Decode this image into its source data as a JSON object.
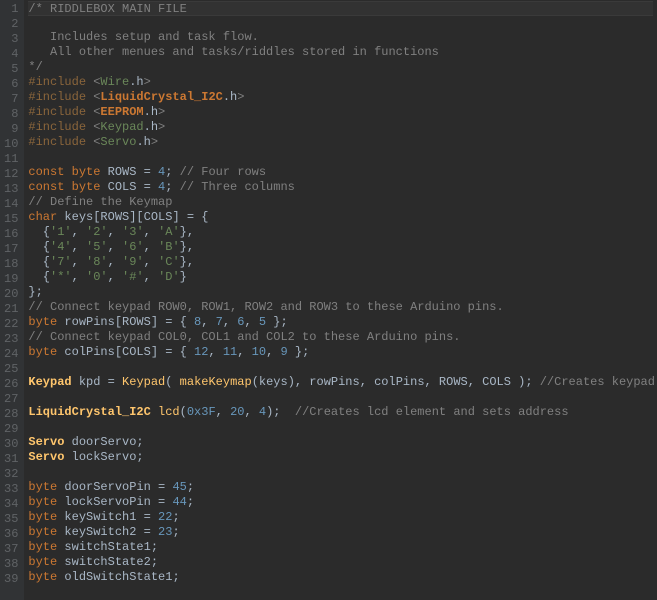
{
  "lines": [
    {
      "n": 1,
      "hl": true,
      "tokens": [
        {
          "c": "comment",
          "t": "/* RIDDLEBOX MAIN FILE"
        }
      ]
    },
    {
      "n": 2,
      "tokens": []
    },
    {
      "n": 3,
      "tokens": [
        {
          "c": "comment",
          "t": "   Includes setup and task flow."
        }
      ]
    },
    {
      "n": 4,
      "tokens": [
        {
          "c": "comment",
          "t": "   All other menues and tasks/riddles stored in functions"
        }
      ]
    },
    {
      "n": 5,
      "tokens": [
        {
          "c": "comment",
          "t": "*/"
        }
      ]
    },
    {
      "n": 6,
      "tokens": [
        {
          "c": "preproc",
          "t": "#include "
        },
        {
          "c": "inc-lt",
          "t": "<"
        },
        {
          "c": "inc-hdr",
          "t": "Wire"
        },
        {
          "c": "ident",
          "t": ".h"
        },
        {
          "c": "inc-lt",
          "t": ">"
        }
      ]
    },
    {
      "n": 7,
      "tokens": [
        {
          "c": "preproc",
          "t": "#include "
        },
        {
          "c": "inc-lt",
          "t": "<"
        },
        {
          "c": "inc-hdr-o",
          "t": "LiquidCrystal_I2C"
        },
        {
          "c": "ident",
          "t": ".h"
        },
        {
          "c": "inc-lt",
          "t": ">"
        }
      ]
    },
    {
      "n": 8,
      "tokens": [
        {
          "c": "preproc",
          "t": "#include "
        },
        {
          "c": "inc-lt",
          "t": "<"
        },
        {
          "c": "inc-hdr-o",
          "t": "EEPROM"
        },
        {
          "c": "ident",
          "t": ".h"
        },
        {
          "c": "inc-lt",
          "t": ">"
        }
      ]
    },
    {
      "n": 9,
      "tokens": [
        {
          "c": "preproc",
          "t": "#include "
        },
        {
          "c": "inc-lt",
          "t": "<"
        },
        {
          "c": "inc-hdr",
          "t": "Keypad"
        },
        {
          "c": "ident",
          "t": ".h"
        },
        {
          "c": "inc-lt",
          "t": ">"
        }
      ]
    },
    {
      "n": 10,
      "tokens": [
        {
          "c": "preproc",
          "t": "#include "
        },
        {
          "c": "inc-lt",
          "t": "<"
        },
        {
          "c": "inc-hdr",
          "t": "Servo"
        },
        {
          "c": "ident",
          "t": ".h"
        },
        {
          "c": "inc-lt",
          "t": ">"
        }
      ]
    },
    {
      "n": 11,
      "tokens": []
    },
    {
      "n": 12,
      "tokens": [
        {
          "c": "keyword",
          "t": "const byte"
        },
        {
          "c": "ident",
          "t": " ROWS = "
        },
        {
          "c": "number",
          "t": "4"
        },
        {
          "c": "ident",
          "t": "; "
        },
        {
          "c": "comment",
          "t": "// Four rows"
        }
      ]
    },
    {
      "n": 13,
      "tokens": [
        {
          "c": "keyword",
          "t": "const byte"
        },
        {
          "c": "ident",
          "t": " COLS = "
        },
        {
          "c": "number",
          "t": "4"
        },
        {
          "c": "ident",
          "t": "; "
        },
        {
          "c": "comment",
          "t": "// Three columns"
        }
      ]
    },
    {
      "n": 14,
      "tokens": [
        {
          "c": "comment",
          "t": "// Define the Keymap"
        }
      ]
    },
    {
      "n": 15,
      "tokens": [
        {
          "c": "keyword",
          "t": "char"
        },
        {
          "c": "ident",
          "t": " keys[ROWS][COLS] = {"
        }
      ]
    },
    {
      "n": 16,
      "tokens": [
        {
          "c": "ident",
          "t": "  {"
        },
        {
          "c": "string",
          "t": "'1'"
        },
        {
          "c": "ident",
          "t": ", "
        },
        {
          "c": "string",
          "t": "'2'"
        },
        {
          "c": "ident",
          "t": ", "
        },
        {
          "c": "string",
          "t": "'3'"
        },
        {
          "c": "ident",
          "t": ", "
        },
        {
          "c": "string",
          "t": "'A'"
        },
        {
          "c": "ident",
          "t": "},"
        }
      ]
    },
    {
      "n": 17,
      "tokens": [
        {
          "c": "ident",
          "t": "  {"
        },
        {
          "c": "string",
          "t": "'4'"
        },
        {
          "c": "ident",
          "t": ", "
        },
        {
          "c": "string",
          "t": "'5'"
        },
        {
          "c": "ident",
          "t": ", "
        },
        {
          "c": "string",
          "t": "'6'"
        },
        {
          "c": "ident",
          "t": ", "
        },
        {
          "c": "string",
          "t": "'B'"
        },
        {
          "c": "ident",
          "t": "},"
        }
      ]
    },
    {
      "n": 18,
      "tokens": [
        {
          "c": "ident",
          "t": "  {"
        },
        {
          "c": "string",
          "t": "'7'"
        },
        {
          "c": "ident",
          "t": ", "
        },
        {
          "c": "string",
          "t": "'8'"
        },
        {
          "c": "ident",
          "t": ", "
        },
        {
          "c": "string",
          "t": "'9'"
        },
        {
          "c": "ident",
          "t": ", "
        },
        {
          "c": "string",
          "t": "'C'"
        },
        {
          "c": "ident",
          "t": "},"
        }
      ]
    },
    {
      "n": 19,
      "tokens": [
        {
          "c": "ident",
          "t": "  {"
        },
        {
          "c": "string",
          "t": "'*'"
        },
        {
          "c": "ident",
          "t": ", "
        },
        {
          "c": "string",
          "t": "'0'"
        },
        {
          "c": "ident",
          "t": ", "
        },
        {
          "c": "string",
          "t": "'#'"
        },
        {
          "c": "ident",
          "t": ", "
        },
        {
          "c": "string",
          "t": "'D'"
        },
        {
          "c": "ident",
          "t": "}"
        }
      ]
    },
    {
      "n": 20,
      "tokens": [
        {
          "c": "ident",
          "t": "};"
        }
      ]
    },
    {
      "n": 21,
      "tokens": [
        {
          "c": "comment",
          "t": "// Connect keypad ROW0, ROW1, ROW2 and ROW3 to these Arduino pins."
        }
      ]
    },
    {
      "n": 22,
      "tokens": [
        {
          "c": "keyword",
          "t": "byte"
        },
        {
          "c": "ident",
          "t": " rowPins[ROWS] = { "
        },
        {
          "c": "number",
          "t": "8"
        },
        {
          "c": "ident",
          "t": ", "
        },
        {
          "c": "number",
          "t": "7"
        },
        {
          "c": "ident",
          "t": ", "
        },
        {
          "c": "number",
          "t": "6"
        },
        {
          "c": "ident",
          "t": ", "
        },
        {
          "c": "number",
          "t": "5"
        },
        {
          "c": "ident",
          "t": " };"
        }
      ]
    },
    {
      "n": 23,
      "tokens": [
        {
          "c": "comment",
          "t": "// Connect keypad COL0, COL1 and COL2 to these Arduino pins."
        }
      ]
    },
    {
      "n": 24,
      "tokens": [
        {
          "c": "keyword",
          "t": "byte"
        },
        {
          "c": "ident",
          "t": " colPins[COLS] = { "
        },
        {
          "c": "number",
          "t": "12"
        },
        {
          "c": "ident",
          "t": ", "
        },
        {
          "c": "number",
          "t": "11"
        },
        {
          "c": "ident",
          "t": ", "
        },
        {
          "c": "number",
          "t": "10"
        },
        {
          "c": "ident",
          "t": ", "
        },
        {
          "c": "number",
          "t": "9"
        },
        {
          "c": "ident",
          "t": " };"
        }
      ]
    },
    {
      "n": 25,
      "tokens": []
    },
    {
      "n": 26,
      "tokens": [
        {
          "c": "classnm",
          "t": "Keypad"
        },
        {
          "c": "ident",
          "t": " kpd = "
        },
        {
          "c": "func",
          "t": "Keypad"
        },
        {
          "c": "ident",
          "t": "( "
        },
        {
          "c": "func",
          "t": "makeKeymap"
        },
        {
          "c": "ident",
          "t": "(keys), rowPins, colPins, ROWS, COLS ); "
        },
        {
          "c": "comment",
          "t": "//Creates keypad element"
        }
      ]
    },
    {
      "n": 27,
      "tokens": []
    },
    {
      "n": 28,
      "tokens": [
        {
          "c": "classnm",
          "t": "LiquidCrystal_I2C"
        },
        {
          "c": "ident",
          "t": " "
        },
        {
          "c": "func",
          "t": "lcd"
        },
        {
          "c": "ident",
          "t": "("
        },
        {
          "c": "number",
          "t": "0x3F"
        },
        {
          "c": "ident",
          "t": ", "
        },
        {
          "c": "number",
          "t": "20"
        },
        {
          "c": "ident",
          "t": ", "
        },
        {
          "c": "number",
          "t": "4"
        },
        {
          "c": "ident",
          "t": ");  "
        },
        {
          "c": "comment",
          "t": "//Creates lcd element and sets address"
        }
      ]
    },
    {
      "n": 29,
      "tokens": []
    },
    {
      "n": 30,
      "tokens": [
        {
          "c": "classnm",
          "t": "Servo"
        },
        {
          "c": "ident",
          "t": " doorServo;"
        }
      ]
    },
    {
      "n": 31,
      "tokens": [
        {
          "c": "classnm",
          "t": "Servo"
        },
        {
          "c": "ident",
          "t": " lockServo;"
        }
      ]
    },
    {
      "n": 32,
      "tokens": []
    },
    {
      "n": 33,
      "tokens": [
        {
          "c": "keyword",
          "t": "byte"
        },
        {
          "c": "ident",
          "t": " doorServoPin = "
        },
        {
          "c": "number",
          "t": "45"
        },
        {
          "c": "ident",
          "t": ";"
        }
      ]
    },
    {
      "n": 34,
      "tokens": [
        {
          "c": "keyword",
          "t": "byte"
        },
        {
          "c": "ident",
          "t": " lockServoPin = "
        },
        {
          "c": "number",
          "t": "44"
        },
        {
          "c": "ident",
          "t": ";"
        }
      ]
    },
    {
      "n": 35,
      "tokens": [
        {
          "c": "keyword",
          "t": "byte"
        },
        {
          "c": "ident",
          "t": " keySwitch1 = "
        },
        {
          "c": "number",
          "t": "22"
        },
        {
          "c": "ident",
          "t": ";"
        }
      ]
    },
    {
      "n": 36,
      "tokens": [
        {
          "c": "keyword",
          "t": "byte"
        },
        {
          "c": "ident",
          "t": " keySwitch2 = "
        },
        {
          "c": "number",
          "t": "23"
        },
        {
          "c": "ident",
          "t": ";"
        }
      ]
    },
    {
      "n": 37,
      "tokens": [
        {
          "c": "keyword",
          "t": "byte"
        },
        {
          "c": "ident",
          "t": " switchState1;"
        }
      ]
    },
    {
      "n": 38,
      "tokens": [
        {
          "c": "keyword",
          "t": "byte"
        },
        {
          "c": "ident",
          "t": " switchState2;"
        }
      ]
    },
    {
      "n": 39,
      "tokens": [
        {
          "c": "keyword",
          "t": "byte"
        },
        {
          "c": "ident",
          "t": " oldSwitchState1;"
        }
      ]
    }
  ]
}
